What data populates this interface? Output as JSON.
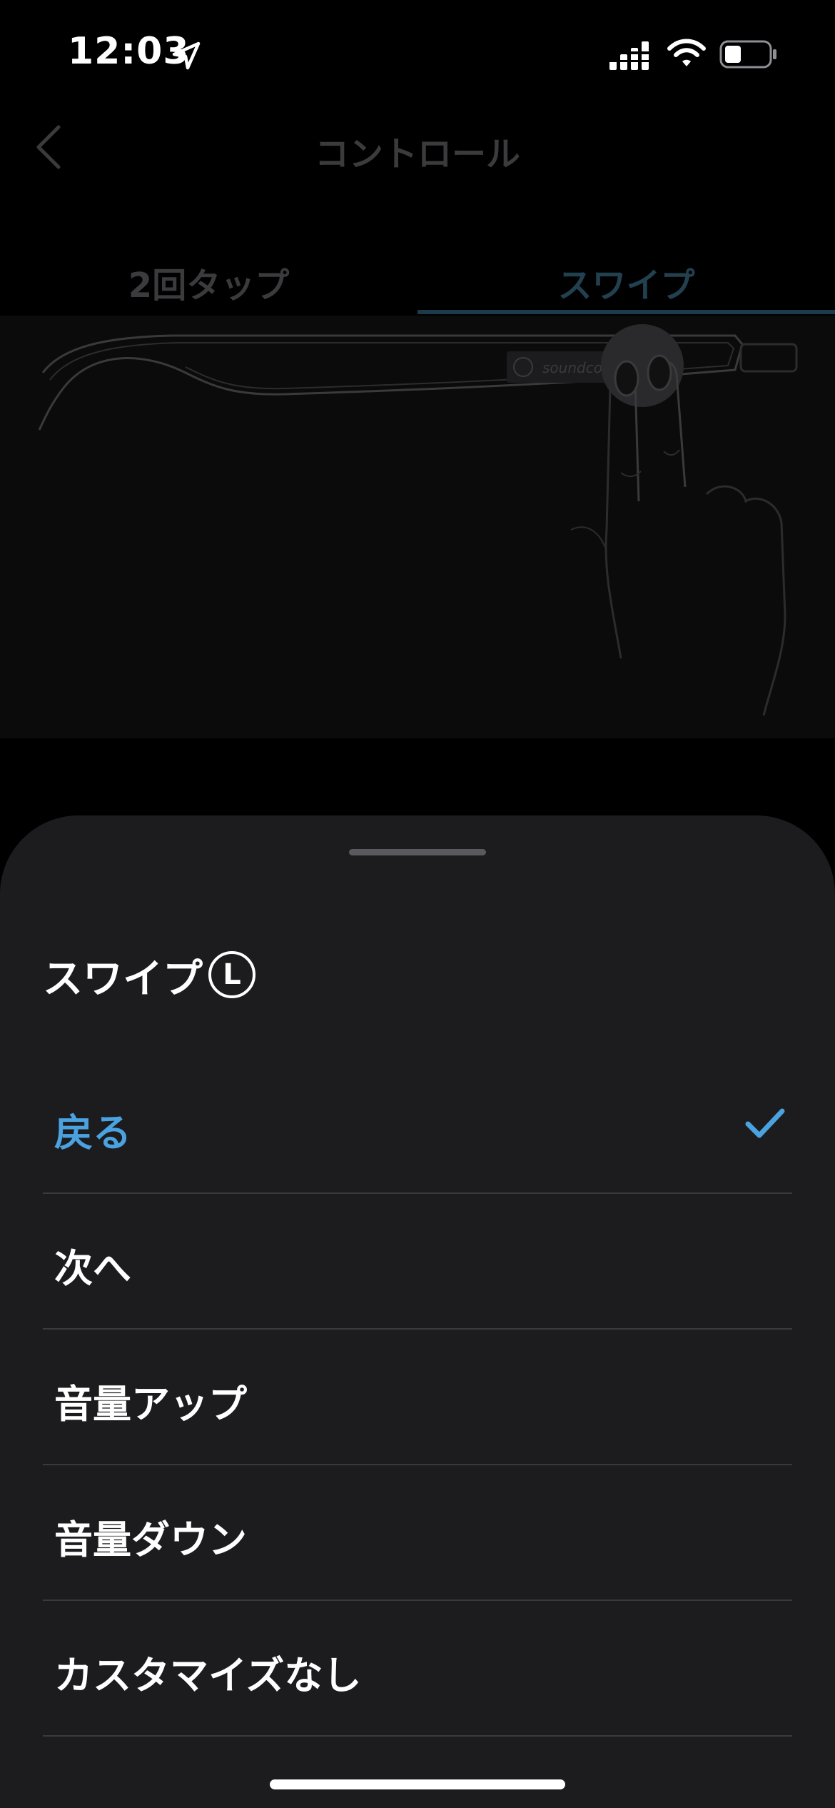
{
  "status_bar": {
    "time": "12:03"
  },
  "header": {
    "title": "コントロール"
  },
  "tabs": [
    {
      "label": "2回タップ",
      "selected": false
    },
    {
      "label": "スワイプ",
      "selected": true
    }
  ],
  "illustration": {
    "brand": "soundcore"
  },
  "sheet": {
    "title": "スワイプ",
    "side_badge": "L",
    "options": [
      {
        "label": "戻る",
        "selected": true
      },
      {
        "label": "次へ",
        "selected": false
      },
      {
        "label": "音量アップ",
        "selected": false
      },
      {
        "label": "音量ダウン",
        "selected": false
      },
      {
        "label": "カスタマイズなし",
        "selected": false
      }
    ]
  },
  "colors": {
    "accent": "#4aa3e0",
    "sheet_background": "#1c1c1e",
    "divider": "#3a3a3c"
  }
}
